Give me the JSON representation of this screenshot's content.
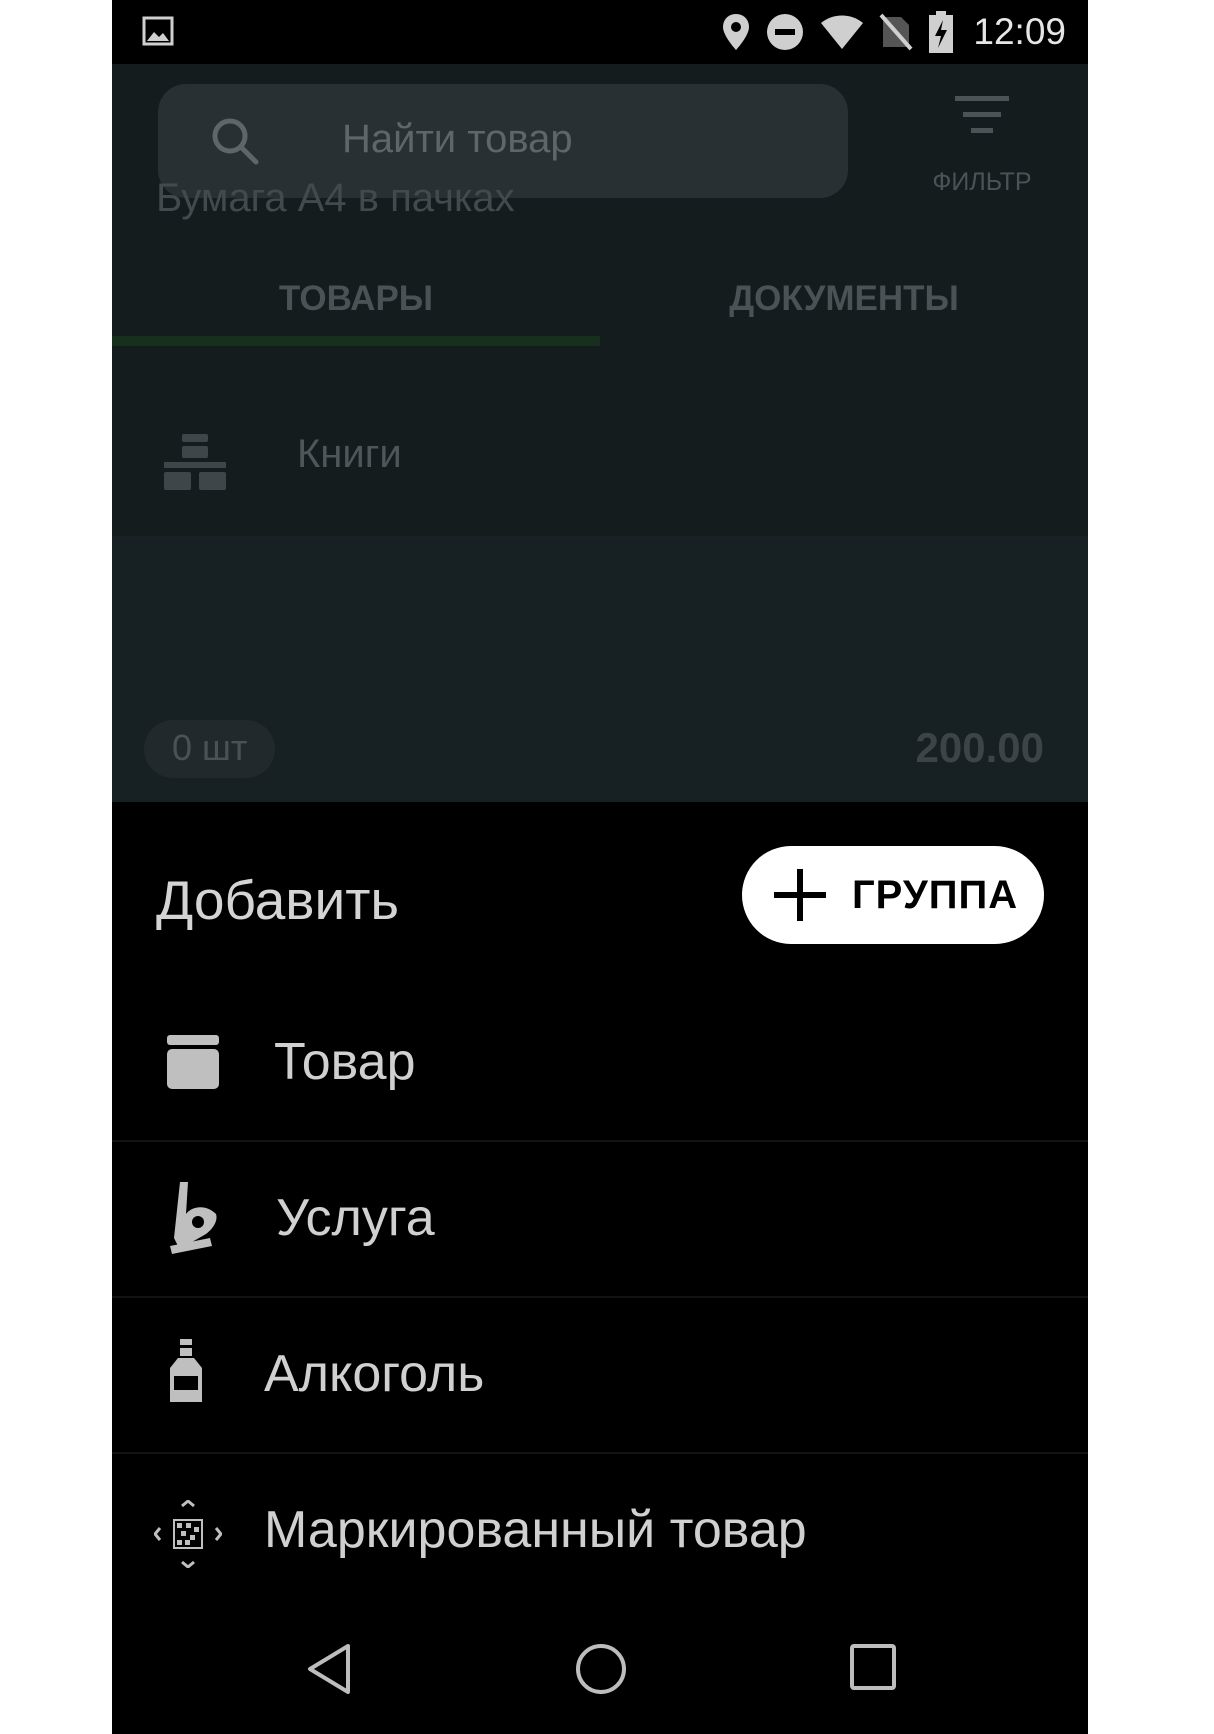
{
  "status_bar": {
    "time": "12:09",
    "icons": [
      "gallery-icon",
      "location-icon",
      "do-not-disturb-icon",
      "wifi-icon",
      "no-sim-icon",
      "battery-charging-icon"
    ]
  },
  "search": {
    "placeholder": "Найти товар",
    "icon": "search-icon"
  },
  "filter": {
    "label": "ФИЛЬТР",
    "icon": "filter-icon"
  },
  "tabs": [
    {
      "label": "ТОВАРЫ",
      "active": true
    },
    {
      "label": "ДОКУМЕНТЫ",
      "active": false
    }
  ],
  "list": {
    "group": {
      "label": "Книги",
      "icon": "product-group-icon"
    },
    "product": {
      "name": "Бумага А4 в пачках",
      "quantity": "0 шт",
      "price": "200.00"
    }
  },
  "sheet": {
    "title": "Добавить",
    "group_button": {
      "label": "ГРУППА",
      "icon": "plus-icon"
    },
    "items": [
      {
        "label": "Товар",
        "icon": "box-icon"
      },
      {
        "label": "Услуга",
        "icon": "service-hand-icon"
      },
      {
        "label": "Алкоголь",
        "icon": "bottle-icon"
      },
      {
        "label": "Маркированный товар",
        "icon": "datamatrix-scan-icon"
      }
    ]
  },
  "nav_bar": {
    "icons": [
      "back-icon",
      "home-icon",
      "recents-icon"
    ]
  },
  "colors": {
    "dim_background": "#141c1e",
    "sheet_background": "#000000",
    "tab_indicator": "#17301d",
    "group_button_bg": "#ffffff"
  }
}
